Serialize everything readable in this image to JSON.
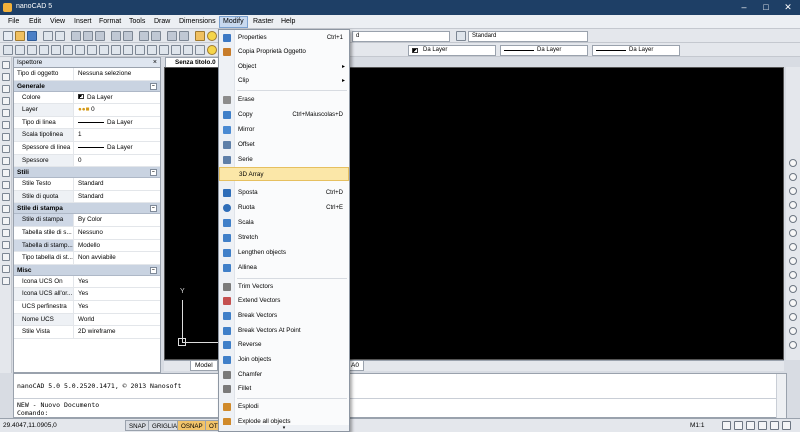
{
  "window": {
    "title": "nanoCAD 5"
  },
  "menubar": [
    "File",
    "Edit",
    "View",
    "Insert",
    "Format",
    "Tools",
    "Draw",
    "Dimensions",
    "Modify",
    "Raster",
    "Help"
  ],
  "toolbar": {
    "layer_combo": "d",
    "text_style": "Standard",
    "color_combo": "Da Layer",
    "linetype_combo": "Da Layer",
    "lineweight_combo": "Da Layer"
  },
  "inspector": {
    "title": "Ispettore",
    "type_label": "Tipo di oggetto",
    "type_value": "Nessuna selezione",
    "sections": [
      {
        "name": "Generale",
        "rows": [
          {
            "k": "Colore",
            "v": "Da Layer",
            "glyph": "swatch"
          },
          {
            "k": "Layer",
            "v": "0",
            "glyph": "layer"
          },
          {
            "k": "Tipo di linea",
            "v": "Da Layer",
            "glyph": "line"
          },
          {
            "k": "Scala tipolinea",
            "v": "1"
          },
          {
            "k": "Spessore di linea",
            "v": "Da Layer",
            "glyph": "line"
          },
          {
            "k": "Spessore",
            "v": "0"
          }
        ]
      },
      {
        "name": "Stili",
        "rows": [
          {
            "k": "Stile Testo",
            "v": "Standard"
          },
          {
            "k": "Stile di quota",
            "v": "Standard"
          }
        ]
      },
      {
        "name": "Stile di stampa",
        "rows": [
          {
            "k": "Stile di stampa",
            "v": "By Color"
          },
          {
            "k": "Tabella stile di s...",
            "v": "Nessuno"
          },
          {
            "k": "Tabella di stamp...",
            "v": "Modello"
          },
          {
            "k": "Tipo tabella di st...",
            "v": "Non avviabile"
          }
        ]
      },
      {
        "name": "Misc",
        "rows": [
          {
            "k": "Icona UCS On",
            "v": "Yes"
          },
          {
            "k": "Icona UCS all'or...",
            "v": "Yes"
          },
          {
            "k": "UCS perfinestra",
            "v": "Yes"
          },
          {
            "k": "Nome UCS",
            "v": "World"
          },
          {
            "k": "Stile Vista",
            "v": "2D wireframe"
          }
        ]
      }
    ]
  },
  "document": {
    "tab": "Senza titolo.0",
    "model_tab": "Model",
    "layout_tab_suffix": "A0",
    "ucs_label": "Y"
  },
  "command": {
    "lines": [
      "nanoCAD 5.0 5.0.2520.1471, © 2013 Nanosoft",
      "NEW - Nuovo Documento",
      "Comando:"
    ]
  },
  "statusbar": {
    "coords": "29.4047,11.0905,0",
    "buttons": [
      "SNAP",
      "GRIGLIA",
      "OSNAP",
      "OTR"
    ],
    "scale": "M1:1"
  },
  "modify_menu": {
    "items": [
      {
        "label": "Properties",
        "shortcut": "Ctrl+1",
        "icon": "properties-icon",
        "color": "#3b78c4"
      },
      {
        "label": "Copia Proprietà Oggetto",
        "icon": "match-props-icon",
        "color": "#c77c2a"
      },
      {
        "label": "Object",
        "submenu": true
      },
      {
        "label": "Clip",
        "submenu": true
      },
      {
        "sep": true
      },
      {
        "label": "Erase",
        "icon": "erase-icon",
        "color": "#8c8c8c"
      },
      {
        "label": "Copy",
        "shortcut": "Ctrl+Maiuscolas+D",
        "icon": "copy-icon",
        "color": "#3f7fc8"
      },
      {
        "label": "Mirror",
        "icon": "mirror-icon",
        "color": "#4a8ad2"
      },
      {
        "label": "Offset",
        "icon": "offset-icon",
        "color": "#5e7fa8"
      },
      {
        "label": "Serie",
        "icon": "array-icon",
        "color": "#5e7fa8"
      },
      {
        "label": "3D Array",
        "highlight": true
      },
      {
        "label": "Sposta",
        "shortcut": "Ctrl+D",
        "icon": "move-icon",
        "color": "#2e6db8"
      },
      {
        "label": "Ruota",
        "shortcut": "Ctrl+E",
        "icon": "rotate-icon",
        "color": "#2e6db8"
      },
      {
        "label": "Scala",
        "icon": "scale-icon",
        "color": "#3f7fc8"
      },
      {
        "label": "Stretch",
        "icon": "stretch-icon",
        "color": "#3f7fc8"
      },
      {
        "label": "Lengthen objects",
        "icon": "lengthen-icon",
        "color": "#3f7fc8"
      },
      {
        "label": "Allinea",
        "icon": "align-icon",
        "color": "#3f7fc8"
      },
      {
        "sep": true
      },
      {
        "label": "Trim Vectors",
        "icon": "trim-icon",
        "color": "#7a7a7a"
      },
      {
        "label": "Extend Vectors",
        "icon": "extend-icon",
        "color": "#c45050"
      },
      {
        "label": "Break Vectors",
        "icon": "break-icon",
        "color": "#3f7fc8"
      },
      {
        "label": "Break Vectors At Point",
        "icon": "break-point-icon",
        "color": "#3f7fc8"
      },
      {
        "label": "Reverse",
        "icon": "reverse-icon",
        "color": "#3f7fc8"
      },
      {
        "label": "Join objects",
        "icon": "join-icon",
        "color": "#3f7fc8"
      },
      {
        "label": "Chamfer",
        "icon": "chamfer-icon",
        "color": "#7a7a7a"
      },
      {
        "label": "Fillet",
        "icon": "fillet-icon",
        "color": "#7a7a7a"
      },
      {
        "sep": true
      },
      {
        "label": "Esplodi",
        "icon": "explode-icon",
        "color": "#d08a2a"
      },
      {
        "label": "Explode all objects",
        "icon": "explode-all-icon",
        "color": "#d08a2a"
      }
    ]
  }
}
